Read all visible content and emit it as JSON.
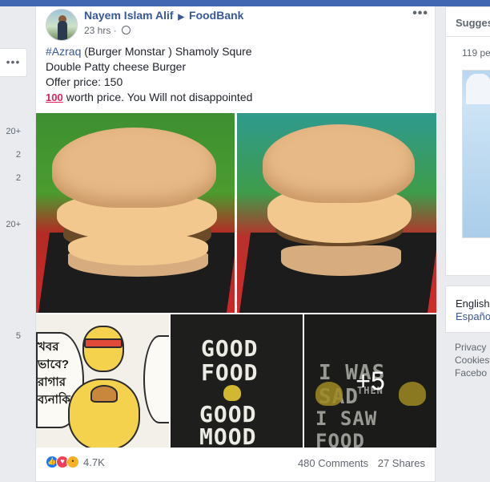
{
  "left_counts": [
    "20+",
    "2",
    "2",
    "20+",
    "5"
  ],
  "more_button": "•••",
  "post": {
    "author": "Nayem Islam Alif",
    "group": "FoodBank",
    "time": "23 hrs",
    "dot": "·",
    "menu": "•••",
    "hashtag": "#Azraq",
    "line1_rest": " (Burger Monstar ) Shamoly Squre",
    "line2": "Double Patty cheese Burger",
    "line3": "Offer price: 150",
    "line4_icon": "100",
    "line4": "worth price. You Will not disappointed",
    "photo_cartoon_text_left": "খবর ভাবে? রাগার ব্যনাকি?",
    "photo_chalk_1": "GOOD",
    "photo_chalk_2": "FOOD",
    "photo_chalk_3": "GOOD",
    "photo_chalk_4": "MOOD",
    "photo_chalk_5": "I WAS SAD",
    "photo_chalk_6": "THEN",
    "photo_chalk_7": "I SAW FOOD",
    "more_photos": "+5",
    "reaction_count": "4.7K",
    "comments": "480 Comments",
    "shares": "27 Shares"
  },
  "right": {
    "suggest_title": "Sugges",
    "suggest_count": "119 pe",
    "lang_current": "English",
    "lang_other": "Españo",
    "footer": [
      "Privacy",
      "Cookies",
      "Facebo"
    ]
  }
}
